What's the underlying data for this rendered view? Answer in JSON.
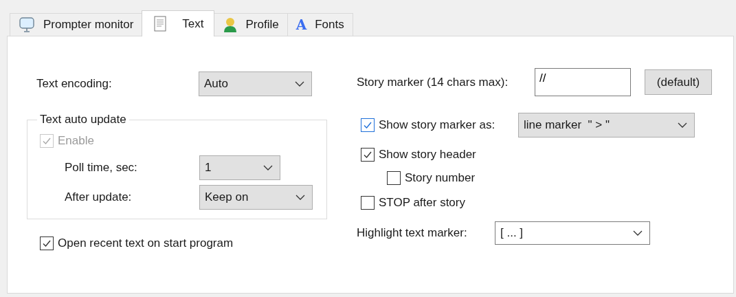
{
  "tabs": [
    {
      "label": "Prompter monitor",
      "selected": false,
      "kind": "monitor"
    },
    {
      "label": "Text",
      "selected": true,
      "kind": "document"
    },
    {
      "label": "Profile",
      "selected": false,
      "kind": "person"
    },
    {
      "label": "Fonts",
      "selected": false,
      "kind": "letter",
      "glyph": "A"
    }
  ],
  "text_encoding": {
    "label": "Text encoding:",
    "value": "Auto"
  },
  "auto_update": {
    "title": "Text auto update",
    "enable": {
      "label": "Enable",
      "checked": true,
      "disabled": true
    },
    "poll_time": {
      "label": "Poll time, sec:",
      "value": "1"
    },
    "after_update": {
      "label": "After update:",
      "value": "Keep on"
    }
  },
  "open_recent": {
    "label": "Open recent text on start program",
    "checked": true
  },
  "story_marker": {
    "label": "Story marker (14 chars max):",
    "value": "//",
    "button": "(default)"
  },
  "show_marker_as": {
    "label": "Show story marker as:",
    "checked": true,
    "focused": true,
    "value": "line marker  \" > \""
  },
  "show_header": {
    "label": "Show story header",
    "checked": true
  },
  "story_number": {
    "label": "Story number",
    "checked": false
  },
  "stop_after": {
    "label": "STOP after story",
    "checked": false
  },
  "highlight_marker": {
    "label": "Highlight text marker:",
    "value": "[ ... ]"
  }
}
